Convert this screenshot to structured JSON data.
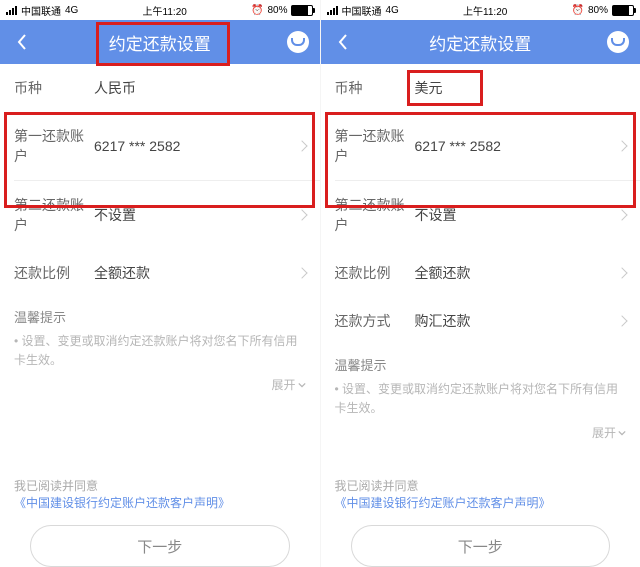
{
  "statusbar": {
    "carrier": "中国联通",
    "network": "4G",
    "time": "上午11:20",
    "battery_pct": "80%"
  },
  "nav": {
    "title": "约定还款设置"
  },
  "left": {
    "currency_label": "币种",
    "currency_value": "人民币",
    "acc1_label": "第一还款账户",
    "acc1_value": "6217 *** 2582",
    "acc2_label": "第二还款账户",
    "acc2_value": "不设置",
    "ratio_label": "还款比例",
    "ratio_value": "全额还款"
  },
  "right": {
    "currency_label": "币种",
    "currency_value": "美元",
    "acc1_label": "第一还款账户",
    "acc1_value": "6217 *** 2582",
    "acc2_label": "第二还款账户",
    "acc2_value": "不设置",
    "ratio_label": "还款比例",
    "ratio_value": "全额还款",
    "method_label": "还款方式",
    "method_value": "购汇还款"
  },
  "tips": {
    "title": "温馨提示",
    "line": "• 设置、变更或取消约定还款账户将对您名下所有信用卡生效。",
    "expand": "展开"
  },
  "agree": {
    "text": "我已阅读并同意",
    "link": "《中国建设银行约定账户还款客户声明》"
  },
  "next": "下一步"
}
